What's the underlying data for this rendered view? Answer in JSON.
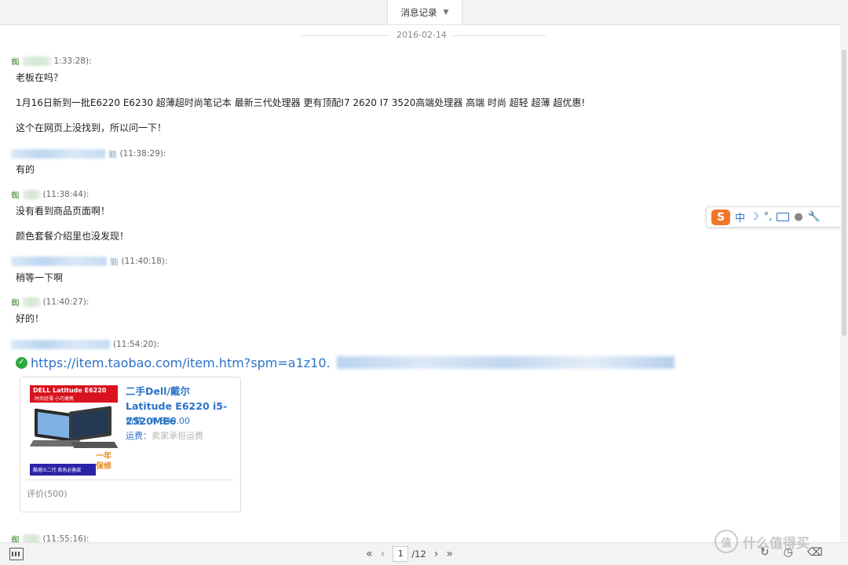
{
  "window": {
    "title": "消息记录"
  },
  "date_separator": "2016-02-14",
  "messages": [
    {
      "sender": "蜘",
      "suffix": "",
      "time": "1:33:28):",
      "lines": [
        "老板在吗？",
        "1月16日新到一批E6220 E6230 超薄超时尚笔记本 最新三代处理器  更有顶配I7 2620 I7 3520高端处理器 高端 时尚 超轻 超薄 超优惠!",
        "这个在网页上没找到，所以问一下！"
      ]
    },
    {
      "sender": "",
      "suffix": "脑",
      "time": "(11:38:29):",
      "lines": [
        "有的"
      ]
    },
    {
      "sender": "蜘",
      "suffix": "",
      "time": "(11:38:44):",
      "lines": [
        "没有看到商品页面啊！",
        "颜色套餐介绍里也没发现！"
      ]
    },
    {
      "sender": "",
      "suffix": "脑",
      "time": "(11:40:18):",
      "lines": [
        "稍等一下啊"
      ]
    },
    {
      "sender": "蜘",
      "suffix": "",
      "time": "(11:40:27):",
      "lines": [
        "好的！"
      ]
    },
    {
      "sender": "",
      "suffix": "",
      "time": "(11:54:20):",
      "lines": []
    },
    {
      "sender": "蜘",
      "suffix": "",
      "time": "(11:55:16):",
      "lines": []
    }
  ],
  "link": {
    "url": "https://item.taobao.com/item.htm?spm=a1z10."
  },
  "product_card": {
    "title": "二手Dell/戴尔 Latitude E6220 i5-2520ME6",
    "price_label": "价格：",
    "price_value": "¥ 849.00",
    "shipping_label": "运费：",
    "shipping_value": "卖家承担运费",
    "rating": "评价(500)",
    "image": {
      "brand": "DELL Latitude E6220",
      "brand_sub": "时尚轻薄 小巧便携",
      "warranty": "一年保修",
      "footer": "酷睿i5二代 商务必备款"
    }
  },
  "ime_toolbar": {
    "logo": "S",
    "mode": "中",
    "moon": "☽",
    "punct": "°,",
    "user": "●"
  },
  "pager": {
    "first": "«",
    "prev": "‹",
    "current": "1",
    "total": "/12",
    "next": "›",
    "last": "»"
  },
  "watermark": {
    "icon": "值",
    "text": "什么值得买"
  },
  "colors": {
    "accent": "#2b73c8",
    "sender_green": "#3c8a2e",
    "check_green": "#2eaa3e"
  }
}
